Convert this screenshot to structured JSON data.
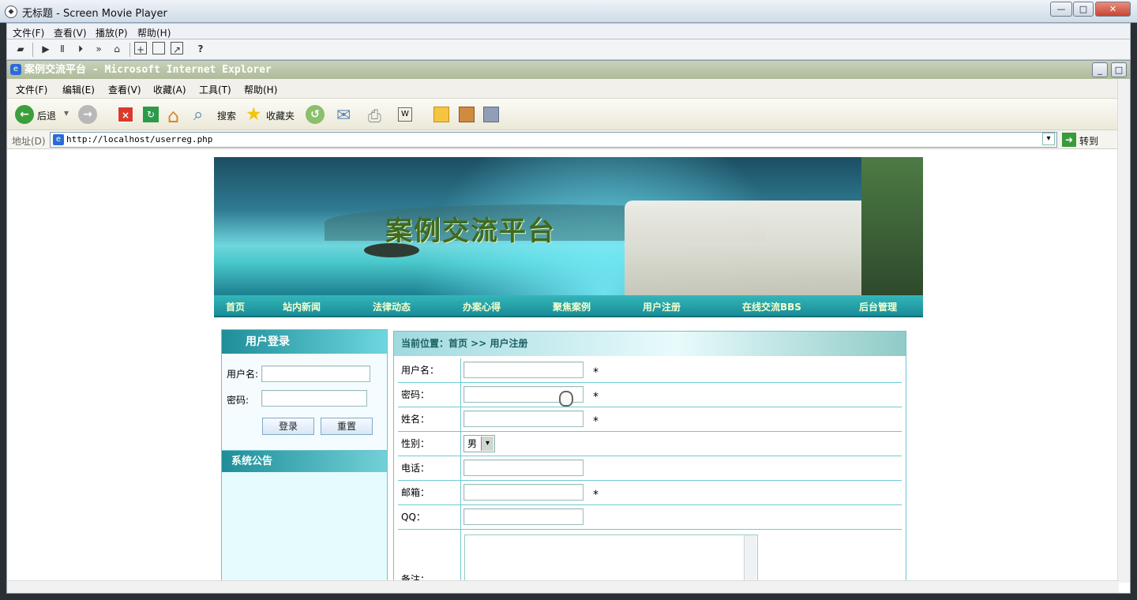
{
  "window": {
    "title": "无标题 - Screen Movie Player",
    "controls": [
      "minimize",
      "maximize",
      "close"
    ]
  },
  "player_menu": [
    "文件(F)",
    "查看(V)",
    "播放(P)",
    "帮助(H)"
  ],
  "player_toolbar": [
    "open-icon",
    "play-icon",
    "pause-icon",
    "step-icon",
    "fast-forward-icon",
    "stop-icon",
    "fit-icon",
    "window-icon",
    "scale-icon",
    "help-icon"
  ],
  "browser": {
    "title": "案例交流平台 - Microsoft Internet Explorer",
    "menu": [
      "文件(F)",
      "编辑(E)",
      "查看(V)",
      "收藏(A)",
      "工具(T)",
      "帮助(H)"
    ],
    "toolbar": {
      "back": "后退",
      "search": "搜索",
      "favorites": "收藏夹"
    },
    "address_label": "地址(D)",
    "address": "http://localhost/userreg.php",
    "go": "转到"
  },
  "site": {
    "banner_title": "案例交流平台",
    "nav": [
      "首页",
      "站内新闻",
      "法律动态",
      "办案心得",
      "聚焦案例",
      "用户注册",
      "在线交流BBS",
      "后台管理"
    ]
  },
  "login": {
    "title": "用户登录",
    "username_label": "用户名:",
    "password_label": "密码:",
    "login_button": "登录",
    "reset_button": "重置"
  },
  "notice": {
    "title": "系统公告"
  },
  "register": {
    "breadcrumb": "当前位置：首页 >> 用户注册",
    "fields": [
      {
        "label": "用户名：",
        "required": true
      },
      {
        "label": "密码：",
        "required": true
      },
      {
        "label": "姓名：",
        "required": true
      },
      {
        "label": "性别：",
        "value": "男"
      },
      {
        "label": "电话：",
        "required": false
      },
      {
        "label": "邮箱：",
        "required": true
      },
      {
        "label": "QQ：",
        "required": false
      },
      {
        "label": "备注："
      }
    ],
    "required_mark": "*"
  }
}
